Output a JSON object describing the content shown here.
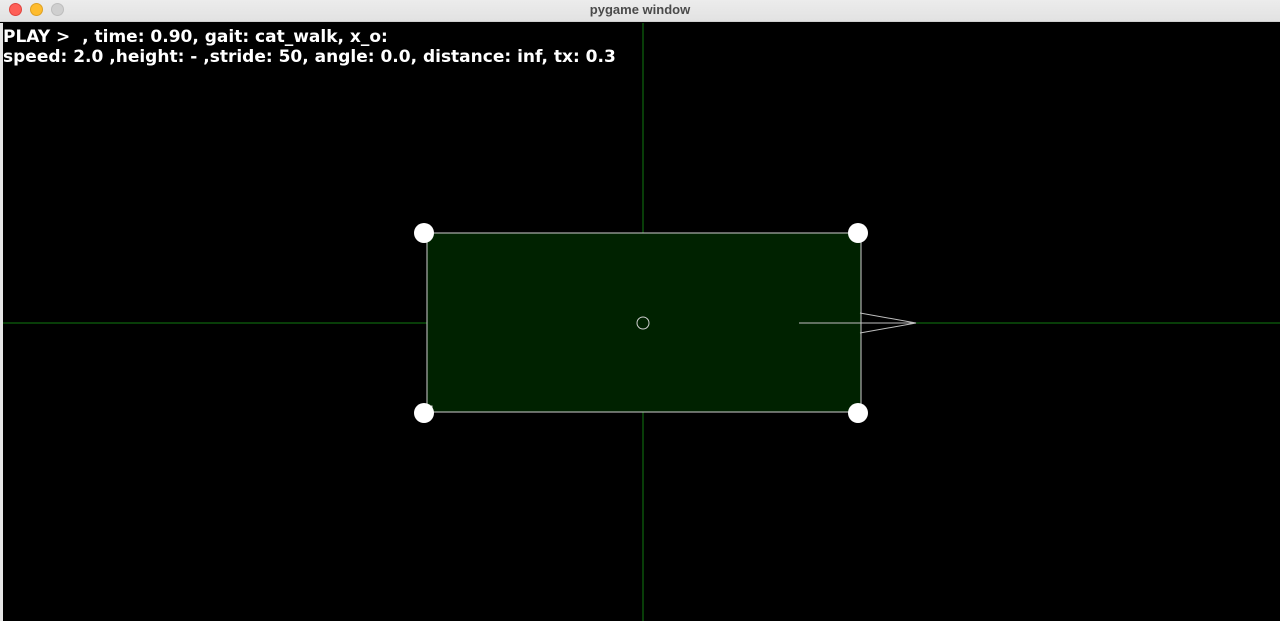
{
  "window": {
    "title": "pygame window"
  },
  "hud": {
    "line1": "PLAY >  , time: 0.90, gait: cat_walk, x_o:",
    "line2": "speed: 2.0 ,height: - ,stride: 50, angle: 0.0, distance: inf, tx: 0.3"
  },
  "colors": {
    "background": "#000000",
    "axis": "#0f7a0f",
    "body_fill": "#002200",
    "body_stroke": "#cfcfcf",
    "leg_dot": "#ffffff",
    "arrow": "#bfbfbf"
  }
}
